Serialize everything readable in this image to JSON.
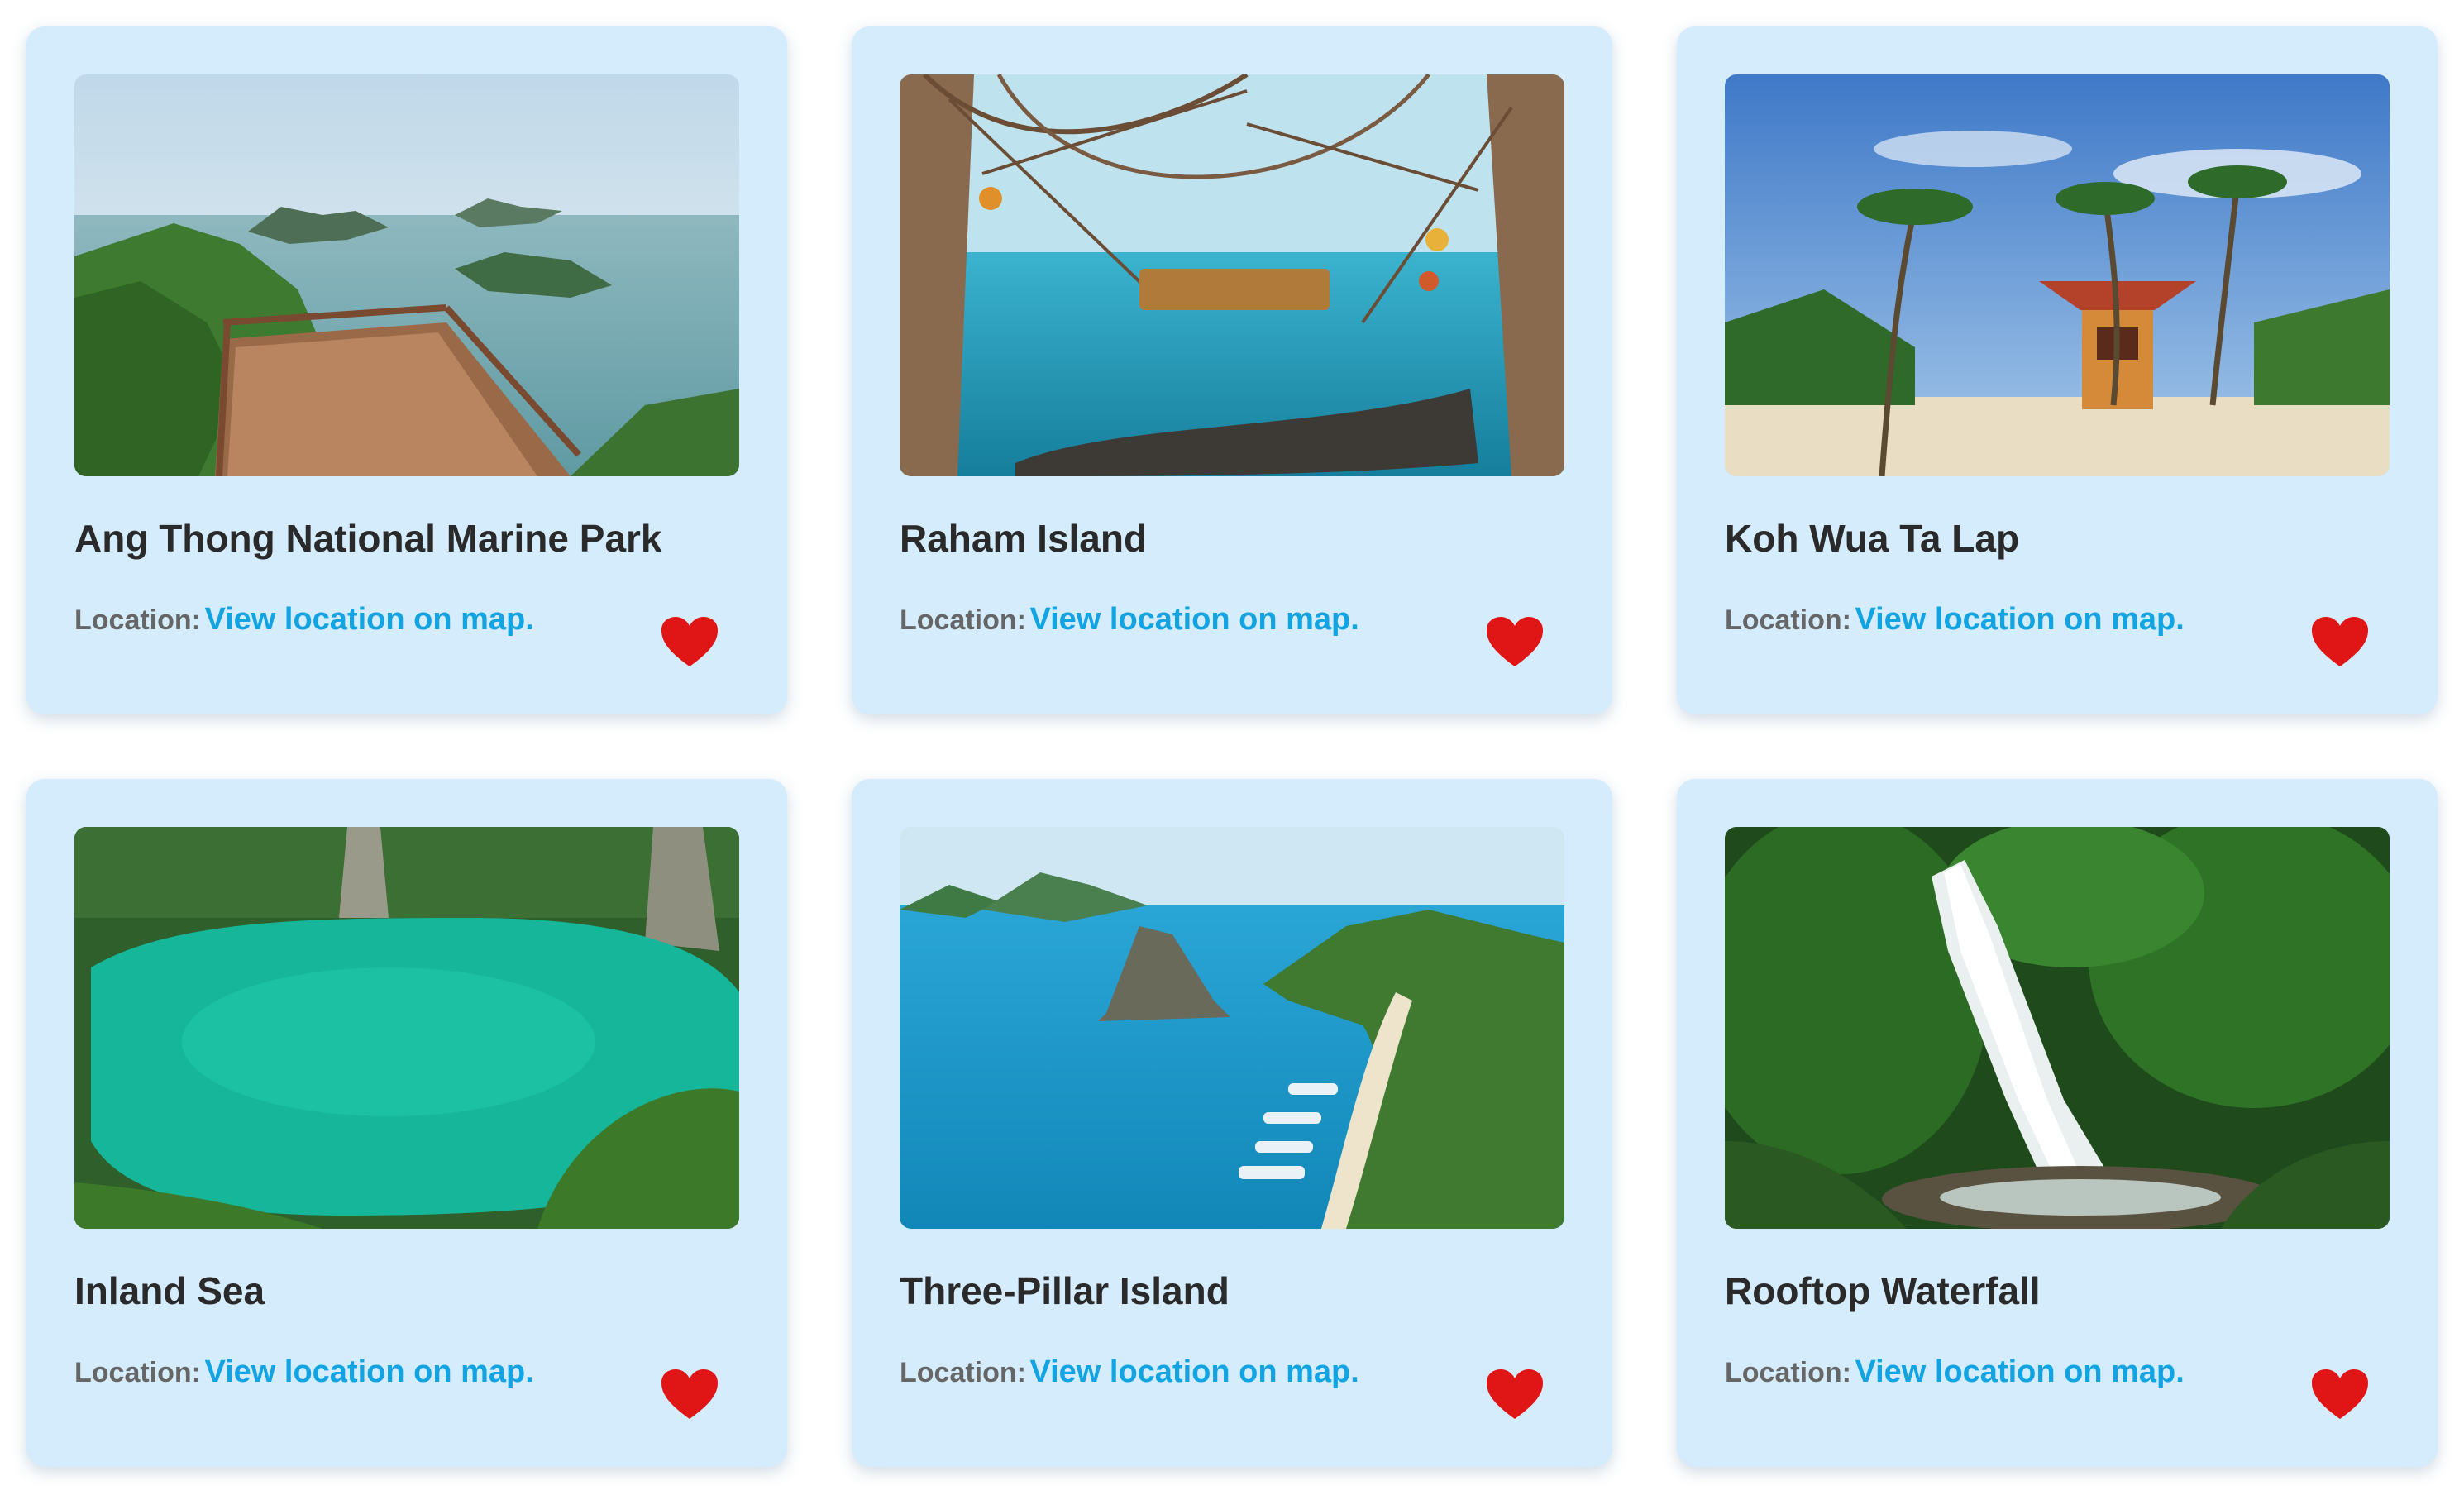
{
  "accent_colors": {
    "card_background": "#d4ecfc",
    "title_text": "#2a2a2a",
    "label_text": "#666666",
    "link": "#12a3e3",
    "heart": "#e01515"
  },
  "cards": [
    {
      "title": "Ang Thong National Marine Park",
      "location_label": "Location:",
      "location_link": "View location on map.",
      "favorite_icon": "heart-icon"
    },
    {
      "title": "Raham Island",
      "location_label": "Location:",
      "location_link": "View location on map.",
      "favorite_icon": "heart-icon"
    },
    {
      "title": "Koh Wua Ta Lap",
      "location_label": "Location:",
      "location_link": "View location on map.",
      "favorite_icon": "heart-icon"
    },
    {
      "title": "Inland Sea",
      "location_label": "Location:",
      "location_link": "View location on map.",
      "favorite_icon": "heart-icon"
    },
    {
      "title": "Three-Pillar Island",
      "location_label": "Location:",
      "location_link": "View location on map.",
      "favorite_icon": "heart-icon"
    },
    {
      "title": "Rooftop Waterfall",
      "location_label": "Location:",
      "location_link": "View location on map.",
      "favorite_icon": "heart-icon"
    }
  ]
}
